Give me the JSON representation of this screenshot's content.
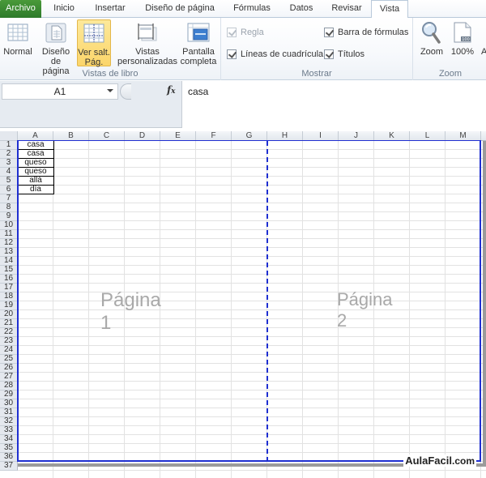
{
  "tabs": [
    {
      "label": "Archivo",
      "active": false,
      "file": true
    },
    {
      "label": "Inicio",
      "active": false
    },
    {
      "label": "Insertar",
      "active": false
    },
    {
      "label": "Diseño de página",
      "active": false
    },
    {
      "label": "Fórmulas",
      "active": false
    },
    {
      "label": "Datos",
      "active": false
    },
    {
      "label": "Revisar",
      "active": false
    },
    {
      "label": "Vista",
      "active": true
    }
  ],
  "ribbon": {
    "vistas_de_libro": {
      "label": "Vistas de libro",
      "buttons": [
        {
          "line1": "Normal",
          "line2": "",
          "icon": "normal-view-icon",
          "selected": false
        },
        {
          "line1": "Diseño",
          "line2": "de página",
          "icon": "page-layout-icon",
          "selected": false
        },
        {
          "line1": "Ver salt.",
          "line2": "Pág.",
          "icon": "page-break-preview-icon",
          "selected": true
        },
        {
          "line1": "Vistas",
          "line2": "personalizadas",
          "icon": "custom-views-icon",
          "selected": false
        },
        {
          "line1": "Pantalla",
          "line2": "completa",
          "icon": "full-screen-icon",
          "selected": false
        }
      ]
    },
    "mostrar": {
      "label": "Mostrar",
      "checkboxes": [
        {
          "label": "Regla",
          "checked": true,
          "disabled": true
        },
        {
          "label": "Líneas de cuadrícula",
          "checked": true,
          "disabled": false
        },
        {
          "label": "Barra de fórmulas",
          "checked": true,
          "disabled": false
        },
        {
          "label": "Títulos",
          "checked": true,
          "disabled": false
        }
      ]
    },
    "zoom": {
      "label": "Zoom",
      "buttons": [
        {
          "label": "Zoom",
          "icon": "magnifier-icon"
        },
        {
          "label": "100%",
          "icon": "zoom-100-icon"
        },
        {
          "label": "A",
          "icon": "zoom-selection-icon"
        }
      ]
    }
  },
  "formula_bar": {
    "name_box": "A1",
    "fx": "fx",
    "value": "casa"
  },
  "sheet": {
    "columns": [
      "A",
      "B",
      "C",
      "D",
      "E",
      "F",
      "G",
      "H",
      "I",
      "J",
      "K",
      "L",
      "M"
    ],
    "row_count": 36,
    "cells_A": [
      "casa",
      "casa",
      "queso",
      "queso",
      "allá",
      "día"
    ],
    "pages": [
      "Página 1",
      "Página 2"
    ],
    "colors": {
      "page_border": "#1f2fd1"
    }
  },
  "watermark": {
    "brand": "AulaFacil",
    "suffix": ".com"
  }
}
